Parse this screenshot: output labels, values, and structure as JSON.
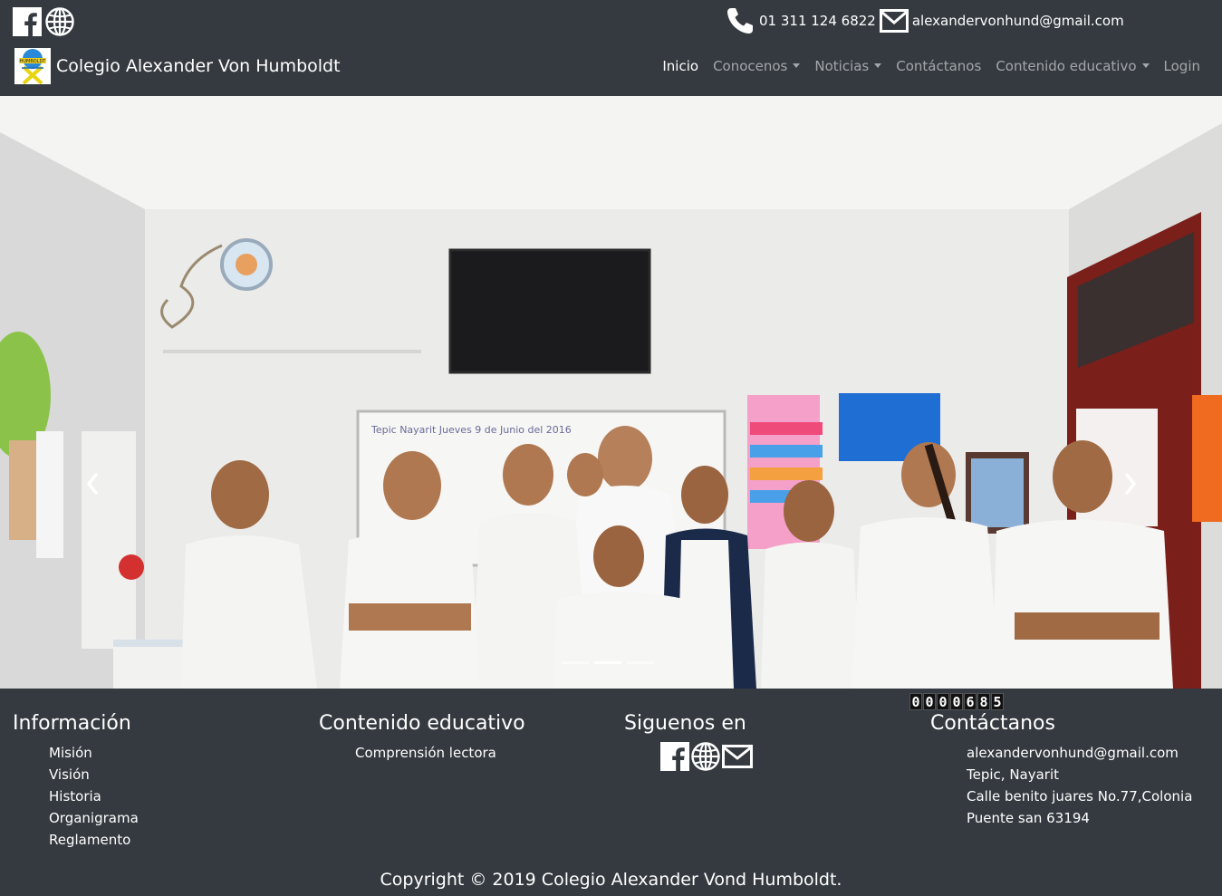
{
  "header": {
    "social_icons": [
      "facebook-icon",
      "globe-icon"
    ],
    "phone": "01 311 124 6822",
    "email": "alexandervonhund@gmail.com",
    "brand_title": "Colegio Alexander Von Humboldt"
  },
  "nav": {
    "items": [
      {
        "label": "Inicio",
        "active": true,
        "dropdown": false
      },
      {
        "label": "Conocenos",
        "active": false,
        "dropdown": true
      },
      {
        "label": "Noticias",
        "active": false,
        "dropdown": true
      },
      {
        "label": "Contáctanos",
        "active": false,
        "dropdown": false
      },
      {
        "label": "Contenido educativo",
        "active": false,
        "dropdown": true
      },
      {
        "label": "Login",
        "active": false,
        "dropdown": false
      }
    ]
  },
  "carousel": {
    "slide_count": 3,
    "active_index": 0,
    "prev_icon": "chevron-left-icon",
    "next_icon": "chevron-right-icon",
    "whiteboard_text": "Tepic Nayarit Jueves 9 de Junio del 2016"
  },
  "counter": {
    "digits": [
      "0",
      "0",
      "0",
      "0",
      "6",
      "8",
      "5"
    ]
  },
  "footer": {
    "informacion": {
      "title": "Información",
      "links": [
        "Misión",
        "Visión",
        "Historia",
        "Organigrama",
        "Reglamento"
      ]
    },
    "contenido": {
      "title": "Contenido educativo",
      "links": [
        "Comprensión lectora"
      ]
    },
    "siguenos": {
      "title": "Siguenos en",
      "icons": [
        "facebook-icon",
        "globe-icon",
        "mail-icon"
      ]
    },
    "contactanos": {
      "title": "Contáctanos",
      "lines": [
        "alexandervonhund@gmail.com",
        "Tepic, Nayarit",
        "Calle benito juares No.77,Colonia",
        "Puente san 63194"
      ]
    },
    "copyright": "Copyright © 2019 Colegio Alexander Vond Humboldt."
  },
  "colors": {
    "background": "#343a40",
    "nav_inactive": "rgba(255,255,255,0.55)",
    "text": "#ffffff"
  }
}
